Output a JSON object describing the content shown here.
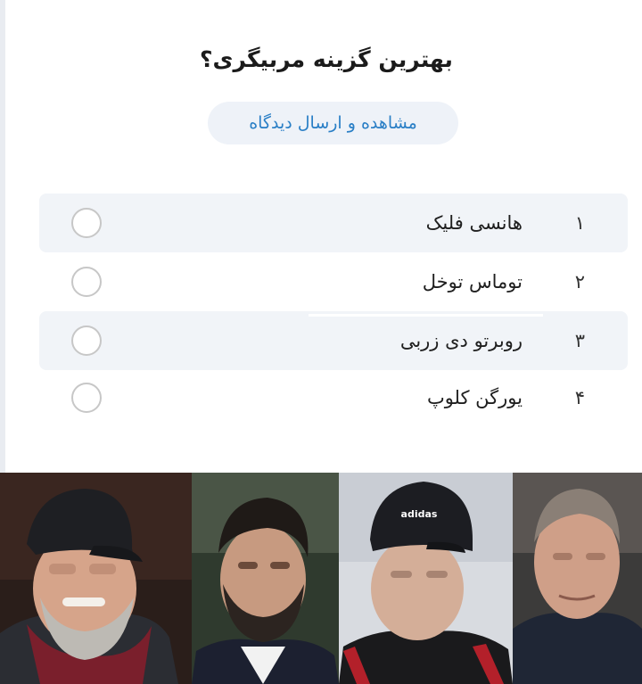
{
  "poll": {
    "title": "بهترین گزینه مربیگری؟",
    "comments_button": "مشاهده و ارسال دیدگاه",
    "options": [
      {
        "number": "۱",
        "label": "هانسی فلیک"
      },
      {
        "number": "۲",
        "label": "توماس توخل"
      },
      {
        "number": "۳",
        "label": "روبرتو دی زربی"
      },
      {
        "number": "۴",
        "label": "یورگن کلوپ"
      }
    ]
  },
  "photos": {
    "cap_brand": "adidas"
  },
  "colors": {
    "accent": "#2a7fc6",
    "option_bg": "#f1f4f8",
    "radio_border": "#c7c7c7"
  }
}
